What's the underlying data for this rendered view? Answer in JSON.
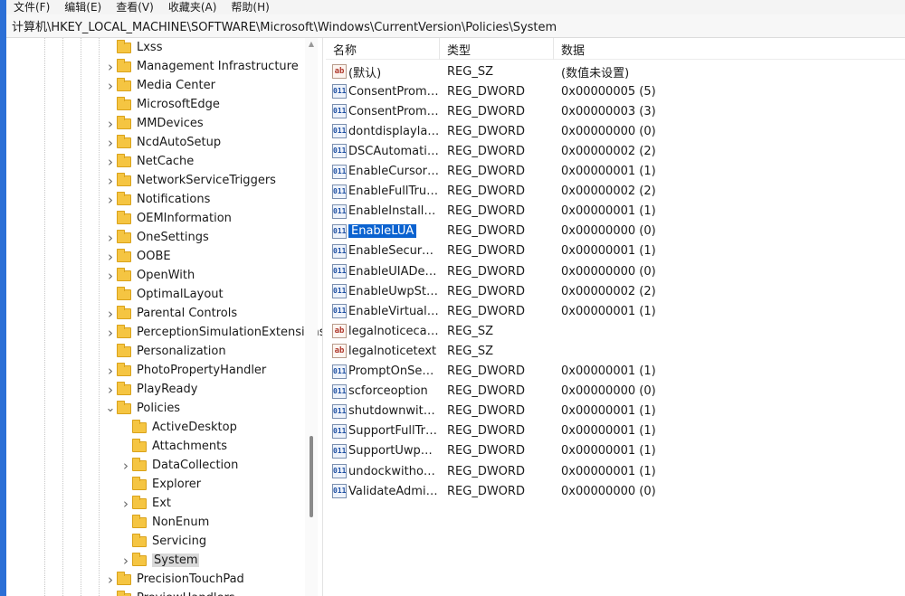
{
  "menu": [
    "文件(F)",
    "编辑(E)",
    "查看(V)",
    "收藏夹(A)",
    "帮助(H)"
  ],
  "address": "计算机\\HKEY_LOCAL_MACHINE\\SOFTWARE\\Microsoft\\Windows\\CurrentVersion\\Policies\\System",
  "tree": [
    {
      "label": "Lxss",
      "level": 0,
      "expander": "none"
    },
    {
      "label": "Management Infrastructure",
      "level": 0,
      "expander": "collapsed"
    },
    {
      "label": "Media Center",
      "level": 0,
      "expander": "collapsed"
    },
    {
      "label": "MicrosoftEdge",
      "level": 0,
      "expander": "none"
    },
    {
      "label": "MMDevices",
      "level": 0,
      "expander": "collapsed"
    },
    {
      "label": "NcdAutoSetup",
      "level": 0,
      "expander": "collapsed"
    },
    {
      "label": "NetCache",
      "level": 0,
      "expander": "collapsed"
    },
    {
      "label": "NetworkServiceTriggers",
      "level": 0,
      "expander": "collapsed"
    },
    {
      "label": "Notifications",
      "level": 0,
      "expander": "collapsed"
    },
    {
      "label": "OEMInformation",
      "level": 0,
      "expander": "none"
    },
    {
      "label": "OneSettings",
      "level": 0,
      "expander": "collapsed"
    },
    {
      "label": "OOBE",
      "level": 0,
      "expander": "collapsed"
    },
    {
      "label": "OpenWith",
      "level": 0,
      "expander": "collapsed"
    },
    {
      "label": "OptimalLayout",
      "level": 0,
      "expander": "none"
    },
    {
      "label": "Parental Controls",
      "level": 0,
      "expander": "collapsed"
    },
    {
      "label": "PerceptionSimulationExtensions",
      "level": 0,
      "expander": "collapsed"
    },
    {
      "label": "Personalization",
      "level": 0,
      "expander": "none"
    },
    {
      "label": "PhotoPropertyHandler",
      "level": 0,
      "expander": "collapsed"
    },
    {
      "label": "PlayReady",
      "level": 0,
      "expander": "collapsed"
    },
    {
      "label": "Policies",
      "level": 0,
      "expander": "expanded"
    },
    {
      "label": "ActiveDesktop",
      "level": 1,
      "expander": "none"
    },
    {
      "label": "Attachments",
      "level": 1,
      "expander": "none"
    },
    {
      "label": "DataCollection",
      "level": 1,
      "expander": "collapsed"
    },
    {
      "label": "Explorer",
      "level": 1,
      "expander": "none"
    },
    {
      "label": "Ext",
      "level": 1,
      "expander": "collapsed"
    },
    {
      "label": "NonEnum",
      "level": 1,
      "expander": "none"
    },
    {
      "label": "Servicing",
      "level": 1,
      "expander": "none"
    },
    {
      "label": "System",
      "level": 1,
      "expander": "collapsed",
      "selected": true
    },
    {
      "label": "PrecisionTouchPad",
      "level": 0,
      "expander": "collapsed"
    },
    {
      "label": "PreviewHandlers",
      "level": 0,
      "expander": "collapsed"
    }
  ],
  "columns": {
    "name": "名称",
    "type": "类型",
    "data": "数据"
  },
  "values": [
    {
      "icon": "sz",
      "name": "(默认)",
      "type": "REG_SZ",
      "data": "(数值未设置)"
    },
    {
      "icon": "dword",
      "name": "ConsentPromp...",
      "type": "REG_DWORD",
      "data": "0x00000005 (5)"
    },
    {
      "icon": "dword",
      "name": "ConsentPromp...",
      "type": "REG_DWORD",
      "data": "0x00000003 (3)"
    },
    {
      "icon": "dword",
      "name": "dontdisplaylas...",
      "type": "REG_DWORD",
      "data": "0x00000000 (0)"
    },
    {
      "icon": "dword",
      "name": "DSCAutomatio...",
      "type": "REG_DWORD",
      "data": "0x00000002 (2)"
    },
    {
      "icon": "dword",
      "name": "EnableCursorS...",
      "type": "REG_DWORD",
      "data": "0x00000001 (1)"
    },
    {
      "icon": "dword",
      "name": "EnableFullTrust...",
      "type": "REG_DWORD",
      "data": "0x00000002 (2)"
    },
    {
      "icon": "dword",
      "name": "EnableInstaller...",
      "type": "REG_DWORD",
      "data": "0x00000001 (1)"
    },
    {
      "icon": "dword",
      "name": "EnableLUA",
      "type": "REG_DWORD",
      "data": "0x00000000 (0)",
      "selected": true
    },
    {
      "icon": "dword",
      "name": "EnableSecureU...",
      "type": "REG_DWORD",
      "data": "0x00000001 (1)"
    },
    {
      "icon": "dword",
      "name": "EnableUIADes...",
      "type": "REG_DWORD",
      "data": "0x00000000 (0)"
    },
    {
      "icon": "dword",
      "name": "EnableUwpSta...",
      "type": "REG_DWORD",
      "data": "0x00000002 (2)"
    },
    {
      "icon": "dword",
      "name": "EnableVirtualiz...",
      "type": "REG_DWORD",
      "data": "0x00000001 (1)"
    },
    {
      "icon": "sz",
      "name": "legalnoticecap...",
      "type": "REG_SZ",
      "data": ""
    },
    {
      "icon": "sz",
      "name": "legalnoticetext",
      "type": "REG_SZ",
      "data": ""
    },
    {
      "icon": "dword",
      "name": "PromptOnSecu...",
      "type": "REG_DWORD",
      "data": "0x00000001 (1)"
    },
    {
      "icon": "dword",
      "name": "scforceoption",
      "type": "REG_DWORD",
      "data": "0x00000000 (0)"
    },
    {
      "icon": "dword",
      "name": "shutdownwitho...",
      "type": "REG_DWORD",
      "data": "0x00000001 (1)"
    },
    {
      "icon": "dword",
      "name": "SupportFullTru...",
      "type": "REG_DWORD",
      "data": "0x00000001 (1)"
    },
    {
      "icon": "dword",
      "name": "SupportUwpSt...",
      "type": "REG_DWORD",
      "data": "0x00000001 (1)"
    },
    {
      "icon": "dword",
      "name": "undockwithout...",
      "type": "REG_DWORD",
      "data": "0x00000001 (1)"
    },
    {
      "icon": "dword",
      "name": "ValidateAdmin...",
      "type": "REG_DWORD",
      "data": "0x00000000 (0)"
    }
  ],
  "icons": {
    "sz": "ab",
    "dword": "011"
  }
}
